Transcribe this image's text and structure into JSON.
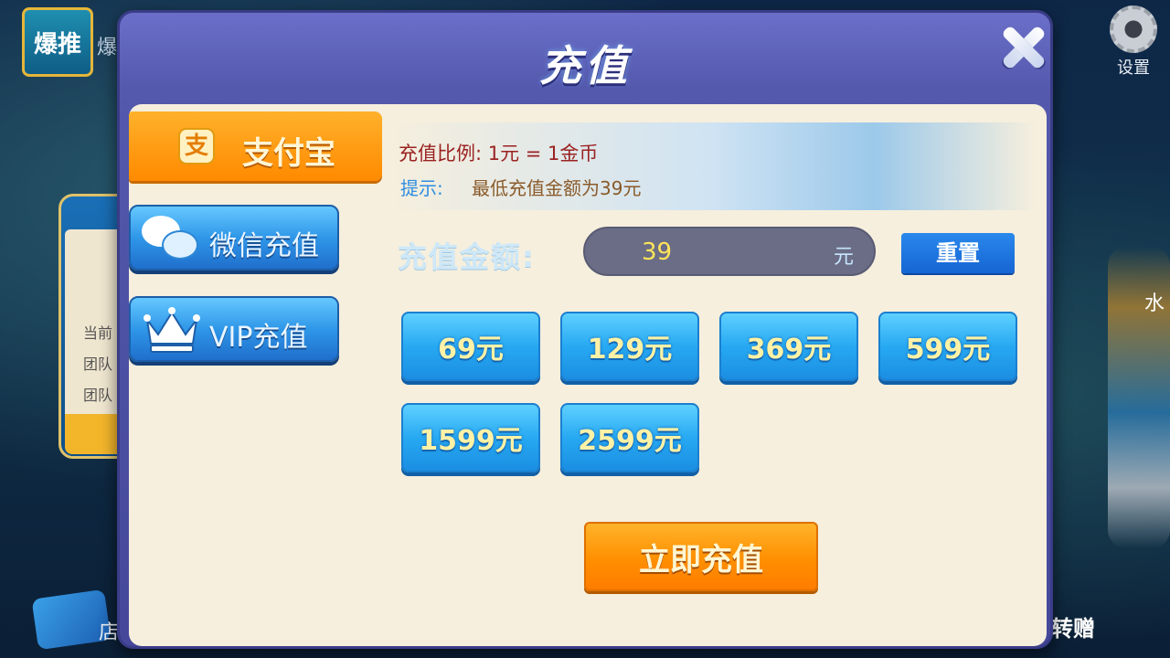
{
  "background": {
    "logo_text": "爆推",
    "logo_side_text": "爆",
    "settings_label": "设置",
    "left_panel": {
      "rows": [
        "当前",
        "团队",
        "团队"
      ]
    },
    "bottom_left_text": "店",
    "bottom_right_text": "转赠",
    "right_char_text": "水"
  },
  "dialog": {
    "title": "充值",
    "tabs": [
      {
        "label": "支付宝",
        "icon": "alipay-icon",
        "icon_glyph": "支"
      },
      {
        "label": "微信充值",
        "icon": "wechat-icon"
      },
      {
        "label": "VIP充值",
        "icon": "crown-icon"
      }
    ],
    "info": {
      "ratio": "充值比例: 1元 = 1金币",
      "hint_label": "提示:",
      "hint_text": "最低充值金额为39元"
    },
    "amount": {
      "label": "充值金额:",
      "value": "39",
      "unit": "元",
      "reset_label": "重置"
    },
    "presets": [
      "69元",
      "129元",
      "369元",
      "599元",
      "1599元",
      "2599元"
    ],
    "submit_label": "立即充值"
  },
  "colors": {
    "orange_accent": "#ff8f00",
    "blue_button": "#27a9f2",
    "panel_bg": "#f6efdd",
    "dialog_frame": "#5459ad"
  }
}
